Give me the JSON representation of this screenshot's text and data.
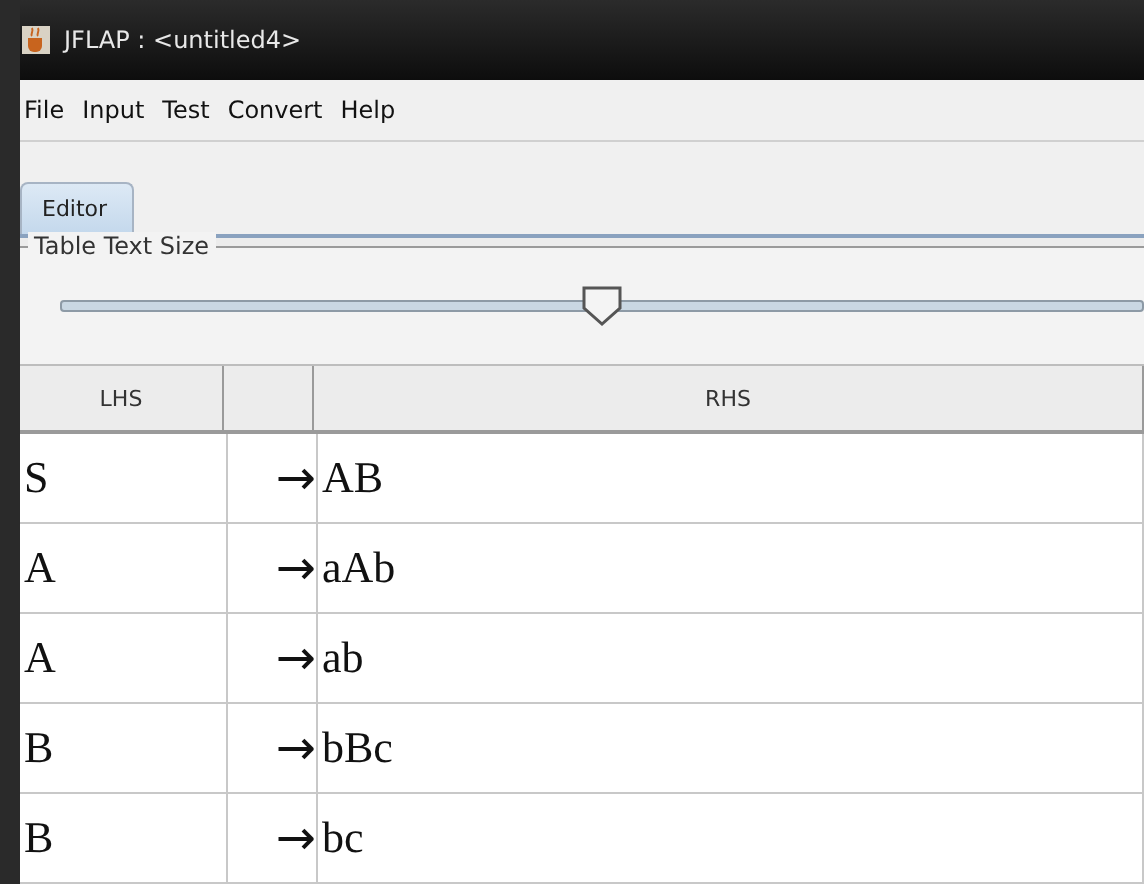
{
  "window": {
    "title": "JFLAP : <untitled4>"
  },
  "menu": [
    "File",
    "Input",
    "Test",
    "Convert",
    "Help"
  ],
  "tabs": [
    {
      "label": "Editor",
      "selected": true
    }
  ],
  "text_size": {
    "title": "Table Text Size",
    "level": 0.5
  },
  "table": {
    "columns": [
      "LHS",
      "",
      "RHS"
    ],
    "rows": [
      {
        "lhs": "S",
        "arrow": "→",
        "rhs": "AB"
      },
      {
        "lhs": "A",
        "arrow": "→",
        "rhs": "aAb"
      },
      {
        "lhs": "A",
        "arrow": "→",
        "rhs": "ab"
      },
      {
        "lhs": "B",
        "arrow": "→",
        "rhs": "bBc"
      },
      {
        "lhs": "B",
        "arrow": "→",
        "rhs": "bc"
      }
    ]
  }
}
